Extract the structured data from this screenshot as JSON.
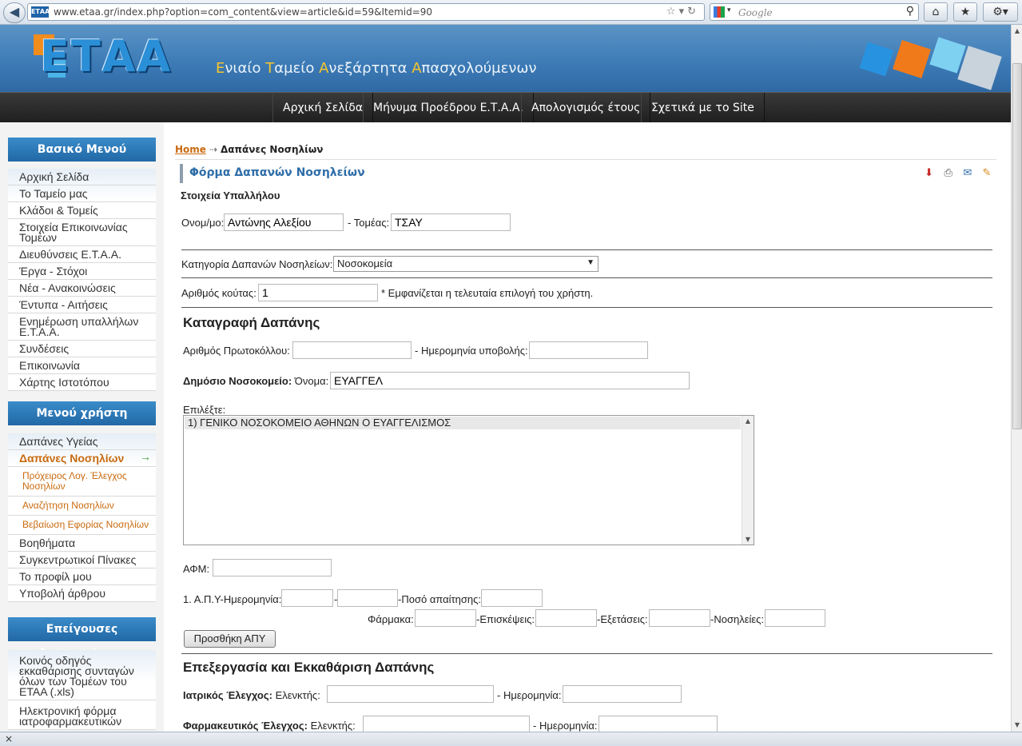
{
  "browser": {
    "url": "www.etaa.gr/index.php?option=com_content&view=article&id=59&Itemid=90",
    "favicon_text": "ΕΤΑΑ",
    "search_placeholder": "Google",
    "back_icon": "back-arrow-icon",
    "home_icon": "home-icon"
  },
  "site": {
    "logo": "ΕΤΑΑ",
    "tagline": [
      {
        "cap": "Ε",
        "rest": "νιαίο "
      },
      {
        "cap": "Τ",
        "rest": "αμείο "
      },
      {
        "cap": "Α",
        "rest": "νεξάρτητα "
      },
      {
        "cap": "Α",
        "rest": "πασχολούμενων"
      }
    ],
    "colors": {
      "header": "#3e7cb7",
      "nav": "#2a2a2a",
      "accent": "#c96a0e",
      "title": "#2f6ea8"
    }
  },
  "topnav": [
    "Αρχική Σελίδα",
    "Μήνυμα Προέδρου Ε.Τ.Α.Α.",
    "Απολογισμός έτους",
    "Σχετικά με το Site"
  ],
  "sidebar": {
    "main_menu_title": "Βασικό Μενού",
    "main_menu": [
      "Αρχική Σελίδα",
      "Το Ταμείο μας",
      "Κλάδοι & Τομείς",
      "Στοιχεία Επικοινωνίας Τομέων",
      "Διευθύνσεις Ε.Τ.Α.Α.",
      "Έργα - Στόχοι",
      "Νέα - Ανακοινώσεις",
      "Έντυπα - Αιτήσεις",
      "Ενημέρωση υπαλλήλων Ε.Τ.Α.Α.",
      "Συνδέσεις",
      "Επικοινωνία",
      "Χάρτης Ιστοτόπου"
    ],
    "user_menu_title": "Μενού χρήστη",
    "user_menu": [
      {
        "label": "Δαπάνες Υγείας",
        "kind": "item"
      },
      {
        "label": "Δαπάνες Νοσηλίων",
        "kind": "active"
      },
      {
        "label": "Πρόχειρος Λογ. Έλεγχος Νοσηλίων",
        "kind": "sub"
      },
      {
        "label": "Αναζήτηση Νοσηλίων",
        "kind": "sub"
      },
      {
        "label": "Βεβαίωση Εφορίας Νοσηλίων",
        "kind": "sub"
      },
      {
        "label": "Βοηθήματα",
        "kind": "item"
      },
      {
        "label": "Συγκεντρωτικοί Πίνακες",
        "kind": "item"
      },
      {
        "label": "Το προφίλ μου",
        "kind": "item"
      },
      {
        "label": "Υποβολή άρθρου",
        "kind": "item"
      }
    ],
    "urgent_title": "Επείγουσες Ανακοινώσεις",
    "urgent": [
      "Κοινός οδηγός εκκαθάρισης συνταγών όλων των Τομέων του ΕΤΑΑ (.xls)",
      "Ηλεκτρονική φόρμα ιατροφαρμακευτικών"
    ]
  },
  "content": {
    "breadcrumb_home": "Home",
    "breadcrumb_current": "Δαπάνες Νοσηλίων",
    "title": "Φόρμα Δαπανών Νοσηλείων",
    "tool_icons": [
      "pdf-icon",
      "print-icon",
      "email-icon",
      "edit-icon"
    ],
    "employee_heading": "Στοιχεία Υπαλλήλου",
    "name_label": "Ονομ/μο:",
    "name_value": "Αντώνης Αλεξίου",
    "sector_label": "- Τομέας:",
    "sector_value": "ΤΣΑΥ",
    "category_label": "Κατηγορία Δαπανών Νοσηλείων:",
    "category_value": "Νοσοκομεία",
    "box_label": "Αριθμός κούτας:",
    "box_value": "1",
    "box_note": "* Εμφανίζεται η τελευταία επιλογή του χρήστη.",
    "record_heading": "Καταγραφή Δαπάνης",
    "protocol_label": "Αριθμός Πρωτοκόλλου:",
    "protocol_value": "",
    "submit_date_label": "- Ημερομηνία υποβολής:",
    "submit_date_value": "",
    "hospital_label": "Δημόσιο Νοσοκομείο:",
    "hospital_name_label": "Όνομα:",
    "hospital_name_value": "ΕΥΑΓΓΕΛ",
    "choose_label": "Επιλέξτε:",
    "hospital_options": [
      "1) ΓΕΝΙΚΟ ΝΟΣΟΚΟΜΕΙΟ ΑΘΗΝΩΝ Ο ΕΥΑΓΓΕΛΙΣΜΟΣ"
    ],
    "afm_label": "ΑΦΜ:",
    "afm_value": "",
    "apy_label": "1. Α.Π.Υ-Ημερομηνία:",
    "dash": "-",
    "claim_label": "-Ποσό απαίτησης:",
    "drugs_label": "Φάρμακα:",
    "visits_label": "-Επισκέψεις:",
    "exams_label": "-Εξετάσεις:",
    "hosp_label": "-Νοσηλείες:",
    "add_apy_button": "Προσθήκη ΑΠΥ",
    "processing_heading": "Επεξεργασία και Εκκαθάριση Δαπάνης",
    "medical_check_label": "Ιατρικός Έλεγχος:",
    "checker_label": "Ελενκτής:",
    "date_label": "- Ημερομηνία:",
    "pharma_check_label": "Φαρμακευτικός Έλεγχος:",
    "pharma_checker_label": "Ελενκτής:"
  },
  "status_bar": "×"
}
